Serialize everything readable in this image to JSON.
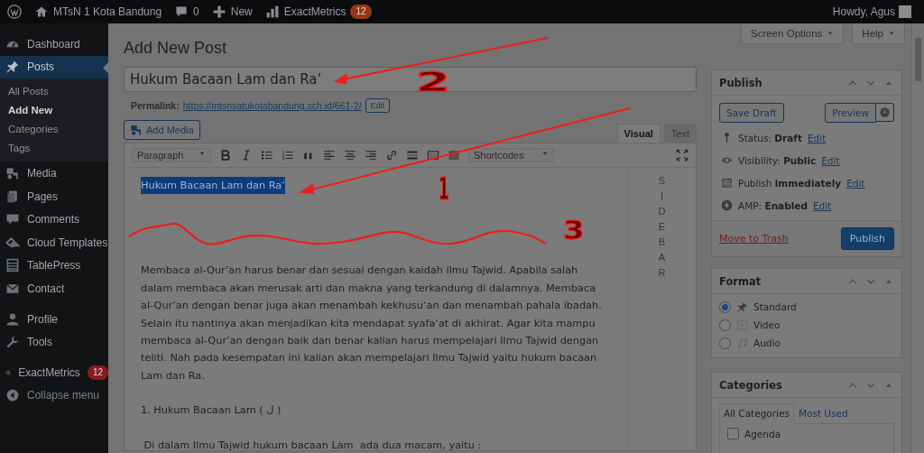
{
  "admin_bar": {
    "site_name": "MTsN 1 Kota Bandung",
    "comments_count": "0",
    "new_label": "New",
    "metrics_label": "ExactMetrics",
    "metrics_badge": "12",
    "greeting": "Howdy, Agus"
  },
  "sidebar": {
    "groups": [
      [
        {
          "label": "Dashboard",
          "selected": false
        },
        {
          "label": "Posts",
          "selected": true,
          "children": [
            {
              "label": "All Posts",
              "selected": false
            },
            {
              "label": "Add New",
              "selected": true
            },
            {
              "label": "Categories",
              "selected": false
            },
            {
              "label": "Tags",
              "selected": false
            }
          ]
        },
        {
          "label": "Media",
          "selected": false
        },
        {
          "label": "Pages",
          "selected": false
        },
        {
          "label": "Comments",
          "selected": false
        },
        {
          "label": "Cloud Templates",
          "selected": false
        },
        {
          "label": "TablePress",
          "selected": false
        },
        {
          "label": "Contact",
          "selected": false
        }
      ],
      [
        {
          "label": "Profile",
          "selected": false
        },
        {
          "label": "Tools",
          "selected": false
        }
      ],
      [
        {
          "label": "ExactMetrics",
          "selected": false,
          "badge": "12"
        },
        {
          "label": "Collapse menu",
          "selected": false
        }
      ]
    ]
  },
  "page": {
    "title": "Add New Post",
    "screen_options": "Screen Options",
    "help": "Help"
  },
  "post": {
    "title_value": "Hukum Bacaan Lam dan Ra’",
    "permalink_label": "Permalink:",
    "permalink_url": "https://mtsnsatukotabandung.sch.id/661-2/",
    "permalink_edit": "Edit"
  },
  "editor": {
    "add_media": "Add Media",
    "tabs": [
      {
        "label": "Visual",
        "selected": true
      },
      {
        "label": "Text",
        "selected": false
      }
    ],
    "format_select": "Paragraph",
    "shortcodes": "Shortcodes",
    "selected_heading": "Hukum Bacaan Lam dan Ra’",
    "side_letters": "SIDEBAR",
    "paragraphs": [
      "Membaca al-Qur’an harus benar dan sesuai dengan kaidah ilmu Tajwid. Apabila salah dalam membaca akan merusak arti dan makna yang terkandung di dalamnya. Membaca al-Qur’an dengan benar juga akan menambah kekhusu’an dan menambah pahala ibadah. Selain itu nantinya akan menjadikan kita mendapat syafa’at di akhirat. Agar kita mampu membaca al-Qur’an dengan baik dan benar kalian harus mempelajari Ilmu Tajwid dengan teliti. Nah pada kesempatan ini kalian akan mempelajari Ilmu Tajwid yaitu hukum bacaan Lam dan Ra.",
      "1. Hukum Bacaan Lam ( ل )",
      " Di dalam Ilmu Tajwid hukum bacaan Lam  ada dua macam, yaitu :"
    ]
  },
  "publish_box": {
    "title": "Publish",
    "save_draft": "Save Draft",
    "preview": "Preview",
    "rows": [
      {
        "label": "Status:",
        "value": "Draft",
        "link": "Edit"
      },
      {
        "label": "Visibility:",
        "value": "Public",
        "link": "Edit"
      },
      {
        "label": "Publish",
        "value": "immediately",
        "link": "Edit"
      },
      {
        "label": "AMP:",
        "value": "Enabled",
        "link": "Edit"
      }
    ],
    "trash": "Move to Trash",
    "publish": "Publish"
  },
  "format_box": {
    "title": "Format",
    "options": [
      {
        "label": "Standard",
        "selected": true
      },
      {
        "label": "Video",
        "selected": false
      },
      {
        "label": "Audio",
        "selected": false
      }
    ]
  },
  "categories_box": {
    "title": "Categories",
    "tabs": [
      {
        "label": "All Categories",
        "selected": true
      },
      {
        "label": "Most Used",
        "selected": false
      }
    ],
    "items": [
      {
        "label": "Agenda",
        "checked": false
      }
    ]
  },
  "annotations": {
    "numbers": [
      {
        "label": "2"
      },
      {
        "label": "1"
      },
      {
        "label": "3"
      }
    ]
  }
}
